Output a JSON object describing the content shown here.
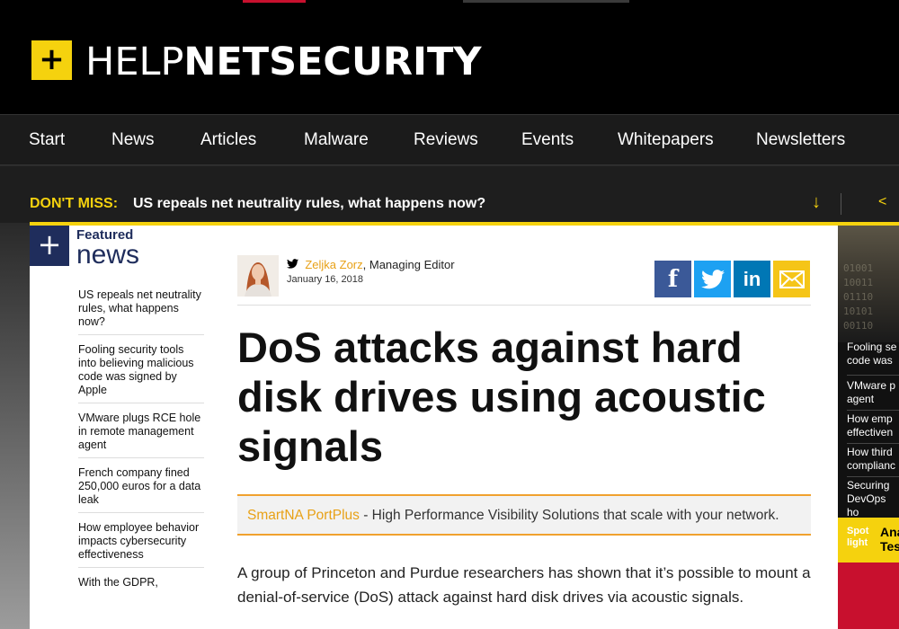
{
  "header": {
    "logo_mark": "+",
    "logo_light": "HELP",
    "logo_bold": "NETSECURITY"
  },
  "nav": {
    "items": [
      {
        "label": "Start"
      },
      {
        "label": "News"
      },
      {
        "label": "Articles"
      },
      {
        "label": "Malware"
      },
      {
        "label": "Reviews"
      },
      {
        "label": "Events"
      },
      {
        "label": "Whitepapers"
      },
      {
        "label": "Newsletters"
      }
    ]
  },
  "dont_miss": {
    "label": "DON'T MISS:",
    "headline": "US repeals net neutrality rules, what happens now?",
    "arrow_icon": "arrow-down-icon",
    "accent": "#f5d20e"
  },
  "featured": {
    "icon": "+",
    "label": "Featured",
    "title": "news",
    "items": [
      {
        "text": "US repeals net neutrality rules, what happens now?"
      },
      {
        "text": "Fooling security tools into believing malicious code was signed by Apple"
      },
      {
        "text": "VMware plugs RCE hole in remote management agent"
      },
      {
        "text": "French company fined 250,000 euros for a data leak"
      },
      {
        "text": "How employee behavior impacts cybersecurity effectiveness"
      },
      {
        "text": "With the GDPR,"
      }
    ]
  },
  "article": {
    "author_name": "Zeljka Zorz",
    "author_role": ", Managing Editor",
    "date": "January 16, 2018",
    "title": "DoS attacks against hard disk drives using acoustic signals",
    "ad_link": "SmartNA PortPlus",
    "ad_text": " - High Performance Visibility Solutions that scale with your network.",
    "body": "A group of Princeton and Purdue researchers has shown that it’s possible to mount a denial-of-service (DoS) attack against hard disk drives via acoustic signals.",
    "share": {
      "facebook_icon": "facebook-icon",
      "twitter_icon": "twitter-icon",
      "linkedin_label": "in",
      "email_icon": "email-icon"
    }
  },
  "rail": {
    "items": [
      {
        "text": "Fooling se code was"
      },
      {
        "text": "VMware p agent"
      },
      {
        "text": "How emp effectiven"
      },
      {
        "text": "How third complianc"
      },
      {
        "text": "Securing DevOps ho"
      }
    ],
    "spot_label": "Spot light",
    "spot_title": "Ana Tes"
  }
}
